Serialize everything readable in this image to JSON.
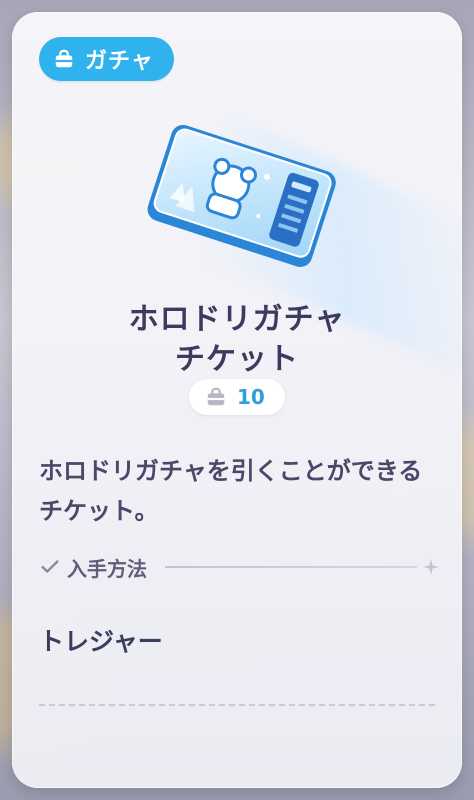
{
  "tag": {
    "icon": "ticket-bag-icon",
    "label": "ガチャ",
    "color": "#2fb2ee"
  },
  "item": {
    "image": "gacha-ticket-icon",
    "title_line1": "ホロドリガチャ",
    "title_line2": "チケット",
    "count_icon": "bag-icon",
    "count": "10",
    "description": "ホロドリガチャを引くことができるチケット。"
  },
  "acquisition": {
    "header_icon": "check-icon",
    "header": "入手方法",
    "method": "トレジャー"
  },
  "colors": {
    "accent": "#2fb2ee",
    "text": "#3c3a5e",
    "count": "#2e9fd8"
  }
}
